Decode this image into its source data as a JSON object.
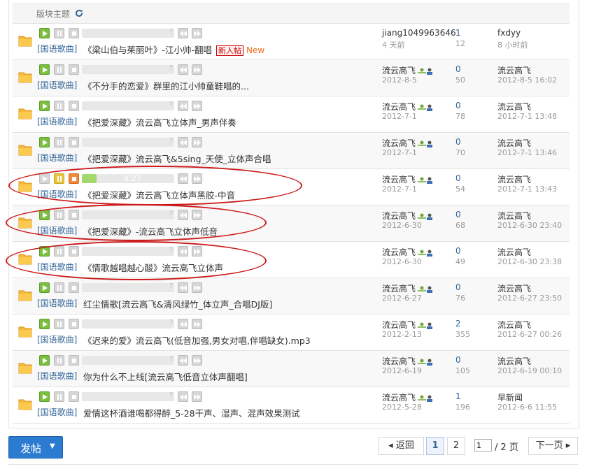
{
  "header": {
    "label": "版块主题",
    "refresh_icon": "refresh-icon"
  },
  "colors": {
    "link": "#336699",
    "accent_new": "#f26c1e",
    "button": "#2b7bd1",
    "annotation_ring": "#cc1a1a",
    "play_green": "#7cbf40"
  },
  "threads": [
    {
      "category": "[国语歌曲]",
      "title": "《梁山伯与茱丽叶》-江小帅-翻唱",
      "new_badge": "新人帖",
      "new_text": "New",
      "author": "jiang1049963646",
      "post_date": "4 天前",
      "replies": "1",
      "views": "12",
      "last_user": "fxdyy",
      "last_time": "8 小时前"
    },
    {
      "category": "[国语歌曲]",
      "title": "《不分手的恋爱》群里的江小帅童鞋唱的...",
      "author": "流云高飞",
      "post_date": "2012-8-5",
      "replies": "0",
      "views": "50",
      "last_user": "流云高飞",
      "last_time": "2012-8-5 16:02"
    },
    {
      "category": "[国语歌曲]",
      "title": "《把爱深藏》流云高飞立体声_男声伴奏",
      "author": "流云高飞",
      "post_date": "2012-7-1",
      "replies": "0",
      "views": "78",
      "last_user": "流云高飞",
      "last_time": "2012-7-1 13:48"
    },
    {
      "category": "[国语歌曲]",
      "title": "《把爱深藏》流云高飞&5sing_天使_立体声合唱",
      "author": "流云高飞",
      "post_date": "2012-7-1",
      "replies": "0",
      "views": "70",
      "last_user": "流云高飞",
      "last_time": "2012-7-1 13:46"
    },
    {
      "category": "[国语歌曲]",
      "title": "《把爱深藏》流云高飞立体声黑胶-中音",
      "author": "流云高飞",
      "post_date": "2012-7-1",
      "replies": "0",
      "views": "54",
      "last_user": "流云高飞",
      "last_time": "2012-7-1 13:43",
      "player_time": "4:27",
      "player_progress": 0.16,
      "playing": true
    },
    {
      "category": "[国语歌曲]",
      "title": "《把爱深藏》-流云高飞立体声低音",
      "author": "流云高飞",
      "post_date": "2012-6-30",
      "replies": "0",
      "views": "68",
      "last_user": "流云高飞",
      "last_time": "2012-6-30 23:40"
    },
    {
      "category": "[国语歌曲]",
      "title": "《情歌越唱越心酸》流云高飞立体声",
      "author": "流云高飞",
      "post_date": "2012-6-30",
      "replies": "0",
      "views": "49",
      "last_user": "流云高飞",
      "last_time": "2012-6-30 23:38"
    },
    {
      "category": "[国语歌曲]",
      "title": "红尘情歌[流云高飞&清风绿竹_体立声_合唱DJ版]",
      "author": "流云高飞",
      "post_date": "2012-6-27",
      "replies": "0",
      "views": "76",
      "last_user": "流云高飞",
      "last_time": "2012-6-27 23:50"
    },
    {
      "category": "[国语歌曲]",
      "title": "《迟来的爱》流云高飞(低音加强,男女对唱,伴唱缺女).mp3",
      "author": "流云高飞",
      "post_date": "2012-2-13",
      "replies": "2",
      "views": "355",
      "last_user": "流云高飞",
      "last_time": "2012-6-27 00:26"
    },
    {
      "category": "[国语歌曲]",
      "title": "你为什么不上线[流云高飞低音立体声翻唱]",
      "author": "流云高飞",
      "post_date": "2012-6-19",
      "replies": "0",
      "views": "105",
      "last_user": "流云高飞",
      "last_time": "2012-6-19 00:10"
    },
    {
      "category": "[国语歌曲]",
      "title": "爱情这杯酒谁喝都得醉_5-28干声、湿声、混声效果测试",
      "author": "流云高飞",
      "post_date": "2012-5-28",
      "replies": "1",
      "views": "196",
      "last_user": "早新闻",
      "last_time": "2012-6-6 11:55"
    }
  ],
  "post_button": {
    "label": "发帖",
    "caret": "▼"
  },
  "pagination": {
    "prev": "◂ 返回",
    "pages": [
      "1",
      "2"
    ],
    "current_value": "1",
    "total": "/ 2 页",
    "next": "下一页 ▸"
  }
}
